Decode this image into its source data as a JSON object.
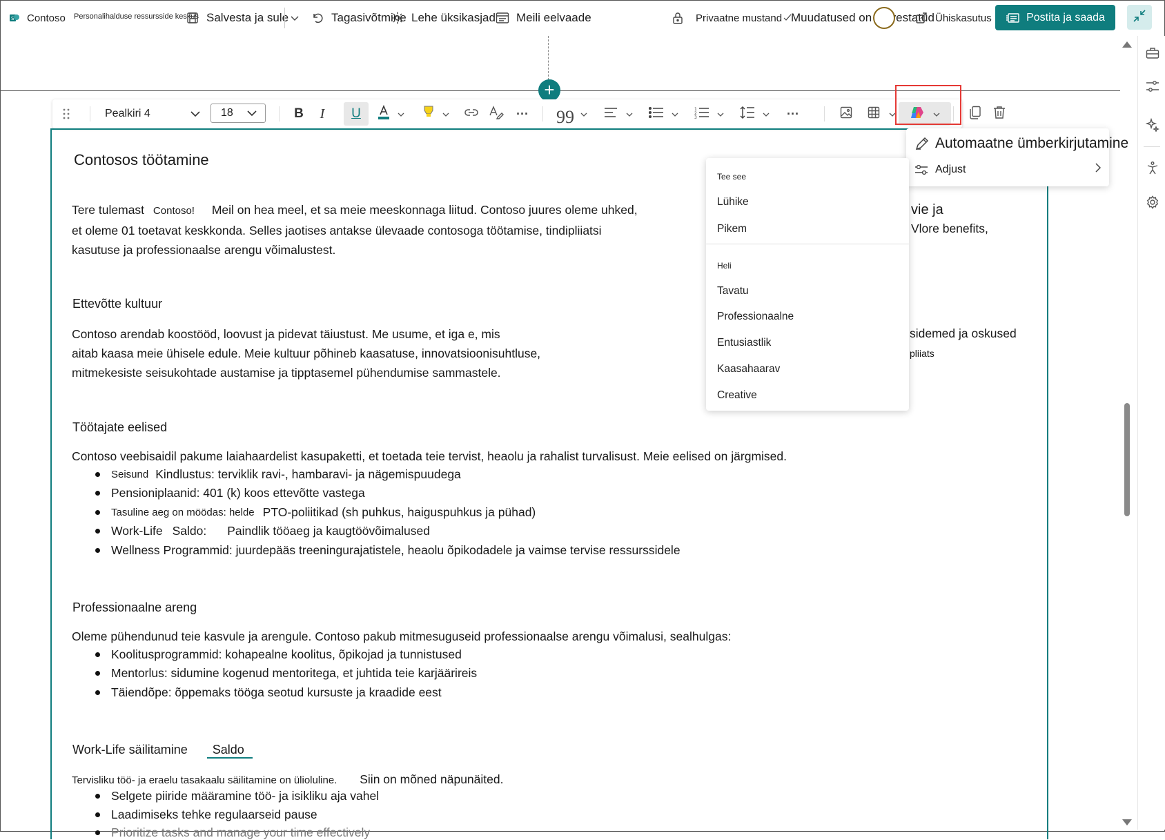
{
  "topbar": {
    "site": "Contoso",
    "page": "Personalihalduse ressursside keskus",
    "save_close": "Salvesta ja sule",
    "undo": "Tagasivõtmine",
    "page_details": "Lehe üksikasjad",
    "email_preview": "Meili eelvaade",
    "private_draft": "Privaatne mustand",
    "saved_status": "Muudatused on salvestatud",
    "share": "Ühiskasutus",
    "post_send": "Postita ja saada"
  },
  "toolbar": {
    "style": "Pealkiri 4",
    "font_size": "18"
  },
  "rewrite_menu": {
    "auto_rewrite": "Automaatne ümberkirjutamine",
    "adjust": "Adjust"
  },
  "adjust_menu": {
    "make_group": "Tee see",
    "short": "Lühike",
    "longer": "Pikem",
    "tone_group": "Heli",
    "options": [
      "Tavatu",
      "Professionaalne",
      "Entusiastlik",
      "Kaasahaarav",
      "Creative"
    ]
  },
  "doc": {
    "title": "Contosos töötamine",
    "intro": {
      "l1a": "Tere tulemast",
      "l1b": "Contoso!",
      "l1c": "Meil on hea meel, et sa meie meeskonnaga liitud. Contoso juures oleme uhked,",
      "l1d": "vie ja",
      "l2a": "et oleme 01 toetavat keskkonda. Selles jaotises antakse ülevaade contosoga töötamise, tindipliiatsi",
      "l2b": "Vlore benefits,",
      "l3": "kasutuse ja professionaalse arengu võimalustest."
    },
    "culture": {
      "heading": "Ettevõtte kultuur",
      "l1a": "Contoso arendab koostööd, loovust ja pidevat täiustust. Me usume, et iga e, mis",
      "l1b": "sidemed ja oskused",
      "l2a": "aitab kaasa meie ühisele edule. Meie kultuur põhineb kaasatuse, innovatsioonisuhtluse,",
      "l2b": "pliiats",
      "l3": "mitmekesiste seisukohtade austamise ja tipptasemel pühendumise sammastele."
    },
    "benefits": {
      "heading": "Töötajate eelised",
      "intro": "Contoso veebisaidil pakume laiahaardelist kasupaketti, et toetada teie tervist, heaolu ja rahalist turvalisust. Meie eelised on järgmised.",
      "b1a": "Seisund",
      "b1b": "Kindlustus: terviklik ravi-, hambaravi- ja nägemispuudega",
      "b2": "Pensioniplaanid: 401 (k) koos ettevõtte vastega",
      "b3a": "Tasuline aeg on möödas: helde",
      "b3b": "PTO-poliitikad (sh puhkus, haiguspuhkus ja pühad)",
      "b4a": "Work-Life",
      "b4b": "Saldo:",
      "b4c": "Paindlik tööaeg ja kaugtöövõimalused",
      "b5": "Wellness Programmid: juurdepääs treeningurajatistele, heaolu õpikodadele ja vaimse tervise ressurssidele"
    },
    "growth": {
      "heading": "Professionaalne areng",
      "intro": "Oleme pühendunud teie kasvule ja arengule. Contoso pakub mitmesuguseid professionaalse arengu võimalusi, sealhulgas:",
      "b1": "Koolitusprogrammid: kohapealne koolitus, õpikojad ja tunnistused",
      "b2": "Mentorlus: sidumine kogenud mentoritega, et juhtida teie karjäärireis",
      "b3": "Täiendõpe: õppemaks tööga seotud kursuste ja kraadide eest"
    },
    "wlb": {
      "heading": "Work-Life säilitamine",
      "heading_b": "Saldo",
      "intro_a": "Tervisliku töö- ja eraelu tasakaalu säilitamine on ülioluline.",
      "intro_b": "Siin on mõned näpunäited.",
      "b1": "Selgete piiride määramine töö- ja isikliku aja vahel",
      "b2": "Laadimiseks tehke regulaarseid pause",
      "b3": "Prioritize tasks and manage your time effectively"
    }
  },
  "colors": {
    "accent": "#0f7d7e",
    "highlight_box": "#e53935"
  }
}
